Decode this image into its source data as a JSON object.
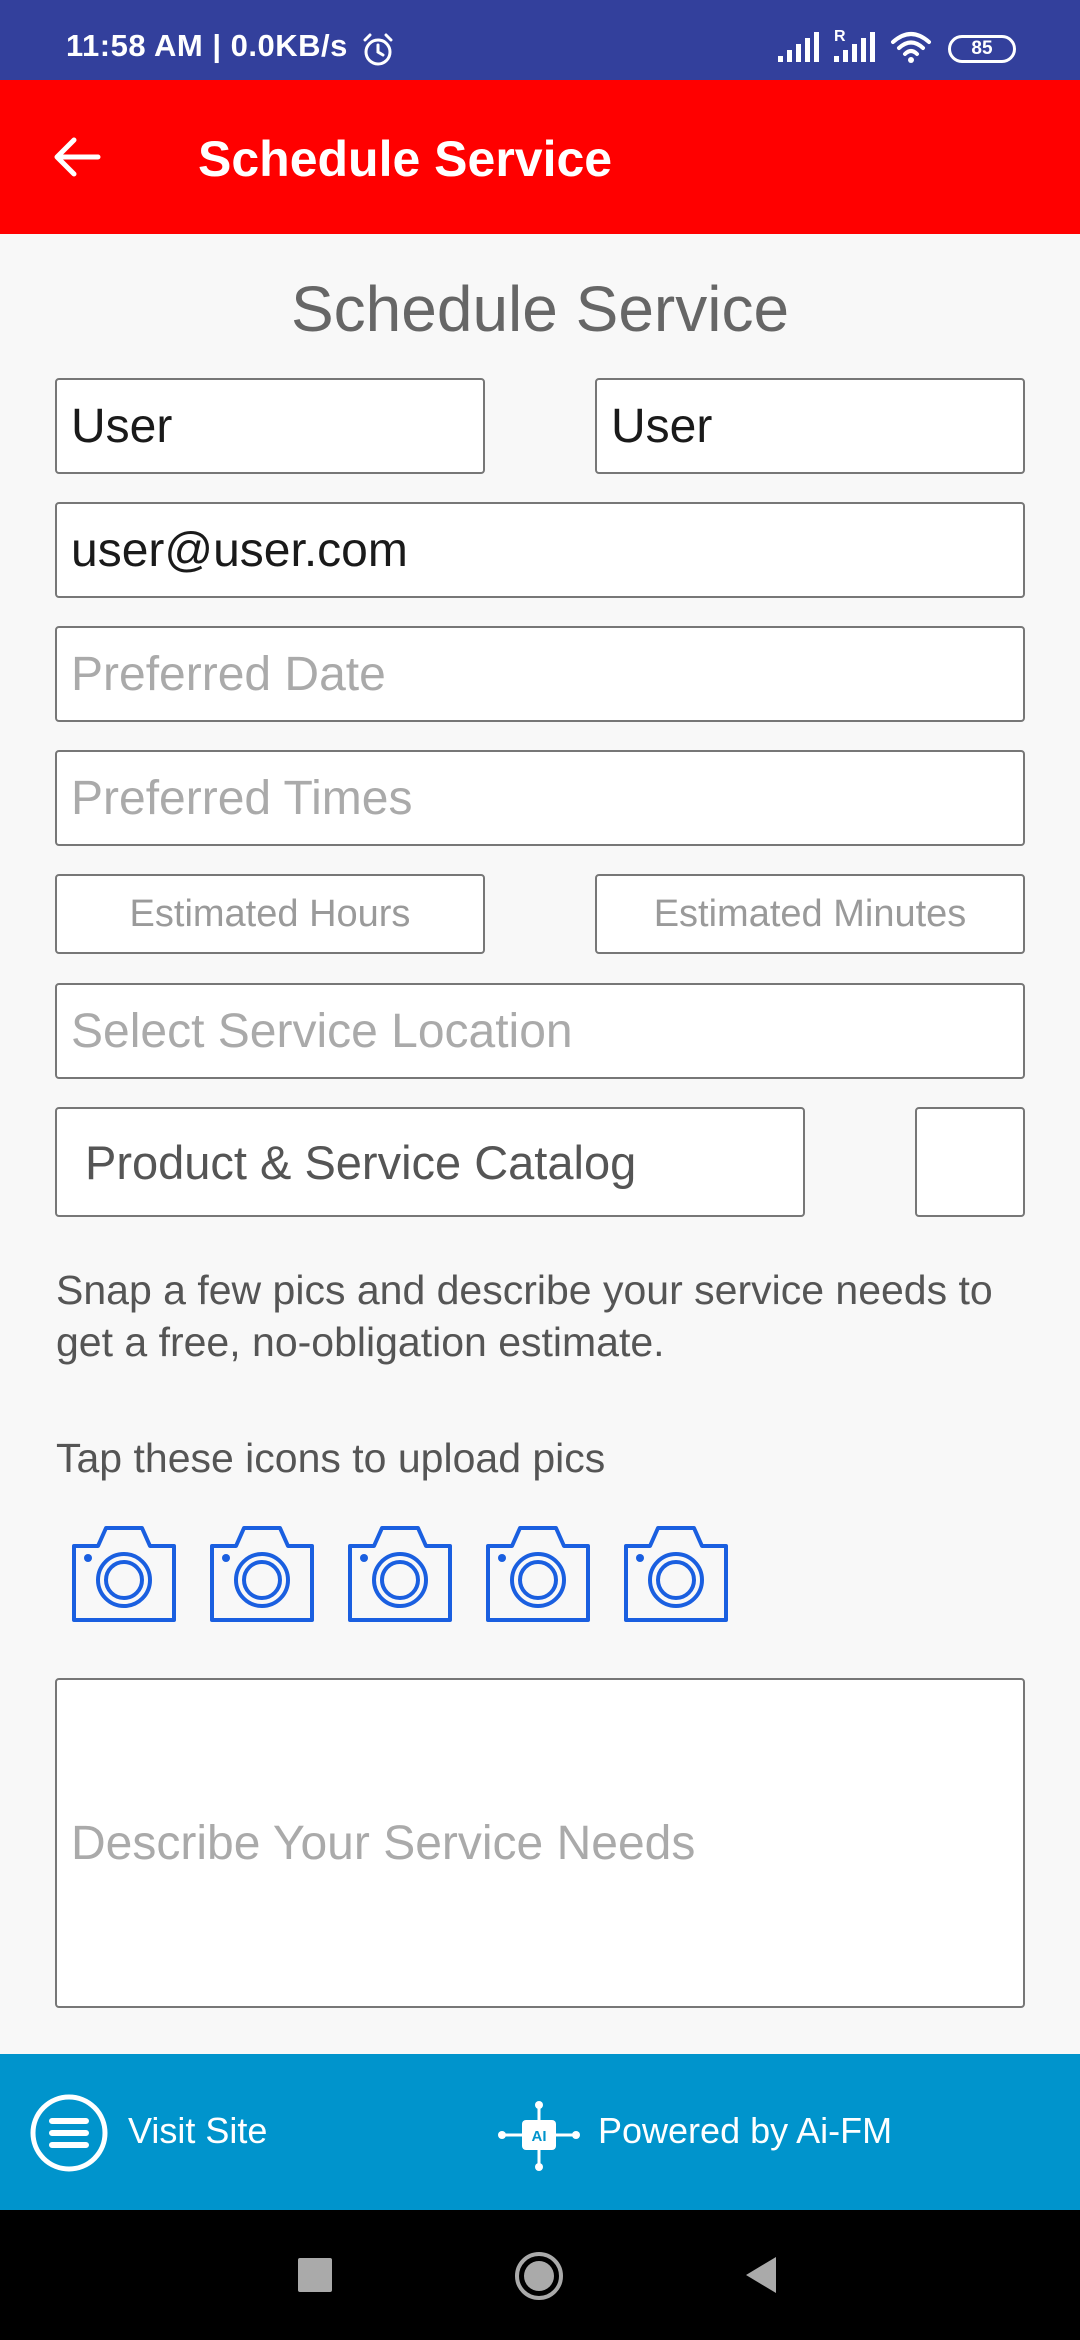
{
  "status_bar": {
    "time": "11:58 AM | 0.0KB/s",
    "roaming": "R",
    "battery": "85"
  },
  "app_bar": {
    "title": "Schedule Service"
  },
  "form": {
    "heading": "Schedule Service",
    "first_name": "User",
    "last_name": "User",
    "email": "user@user.com",
    "preferred_date_placeholder": "Preferred Date",
    "preferred_times_placeholder": "Preferred Times",
    "estimated_hours_placeholder": "Estimated Hours",
    "estimated_minutes_placeholder": "Estimated Minutes",
    "service_location_placeholder": "Select Service Location",
    "catalog_label": "Product & Service Catalog",
    "info_text": "Snap a few pics and describe your service needs to get a free, no-obligation estimate.",
    "upload_hint": "Tap these icons to upload pics",
    "upload_icons": [
      "camera-icon",
      "camera-icon",
      "camera-icon",
      "camera-icon",
      "camera-icon"
    ],
    "description_placeholder": "Describe Your Service Needs"
  },
  "footer": {
    "visit_site": "Visit Site",
    "powered_by": "Powered by Ai-FM",
    "ai_badge": "AI"
  },
  "colors": {
    "status_bar": "#33409c",
    "app_bar": "#ff0000",
    "footer": "#0094cc",
    "camera_icon": "#1a5fe0"
  }
}
